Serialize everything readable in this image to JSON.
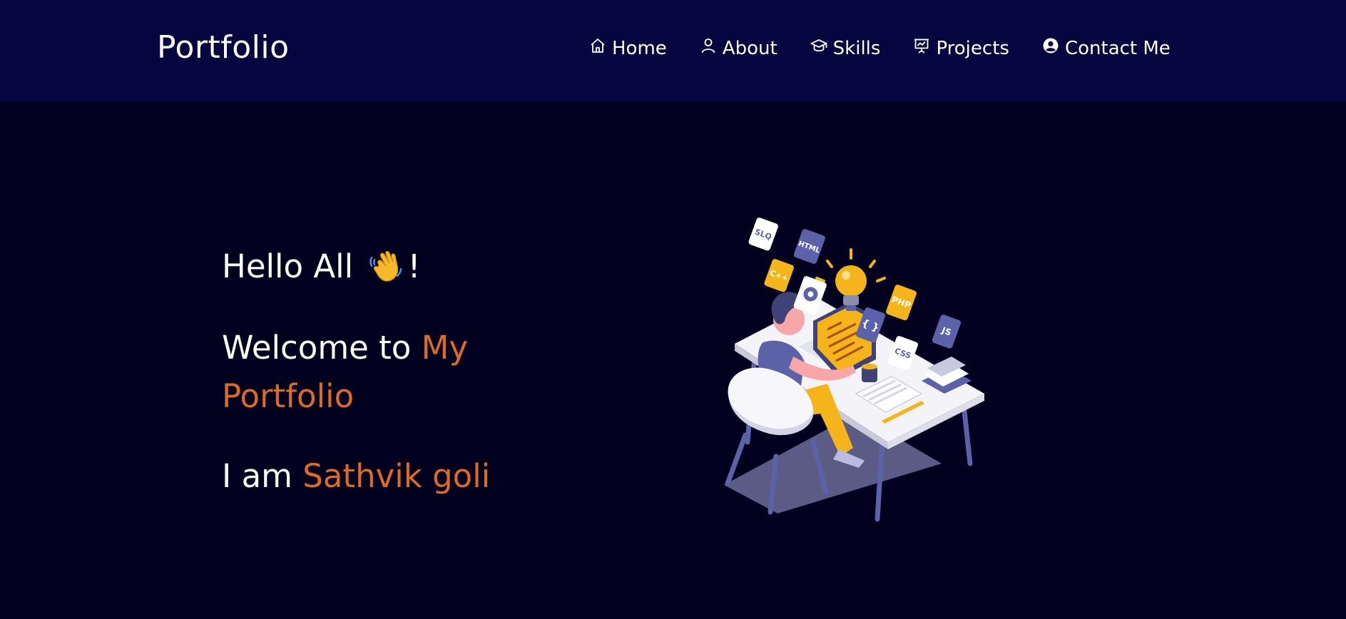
{
  "navbar": {
    "brand": "Portfolio",
    "links": [
      {
        "label": "Home",
        "icon": "home-icon"
      },
      {
        "label": "About",
        "icon": "user-icon"
      },
      {
        "label": "Skills",
        "icon": "graduation-cap-icon"
      },
      {
        "label": "Projects",
        "icon": "presentation-chart-icon"
      },
      {
        "label": "Contact Me",
        "icon": "user-circle-icon"
      }
    ]
  },
  "hero": {
    "greeting": "Hello All",
    "greeting_emoji": "waving-hand-icon",
    "greeting_suffix": "!",
    "welcome_prefix": "Welcome to ",
    "welcome_highlight": "My Portfolio",
    "intro_prefix": "I am ",
    "intro_name": "Sathvik goli"
  },
  "illustration": {
    "tags": [
      "SLQ",
      "HTML",
      "C++",
      "PHP",
      "JS",
      "CSS",
      "{ }"
    ]
  },
  "colors": {
    "navbar_bg": "#050540",
    "page_bg": "#01001f",
    "accent": "#dc6c25",
    "text": "#ffffff"
  }
}
